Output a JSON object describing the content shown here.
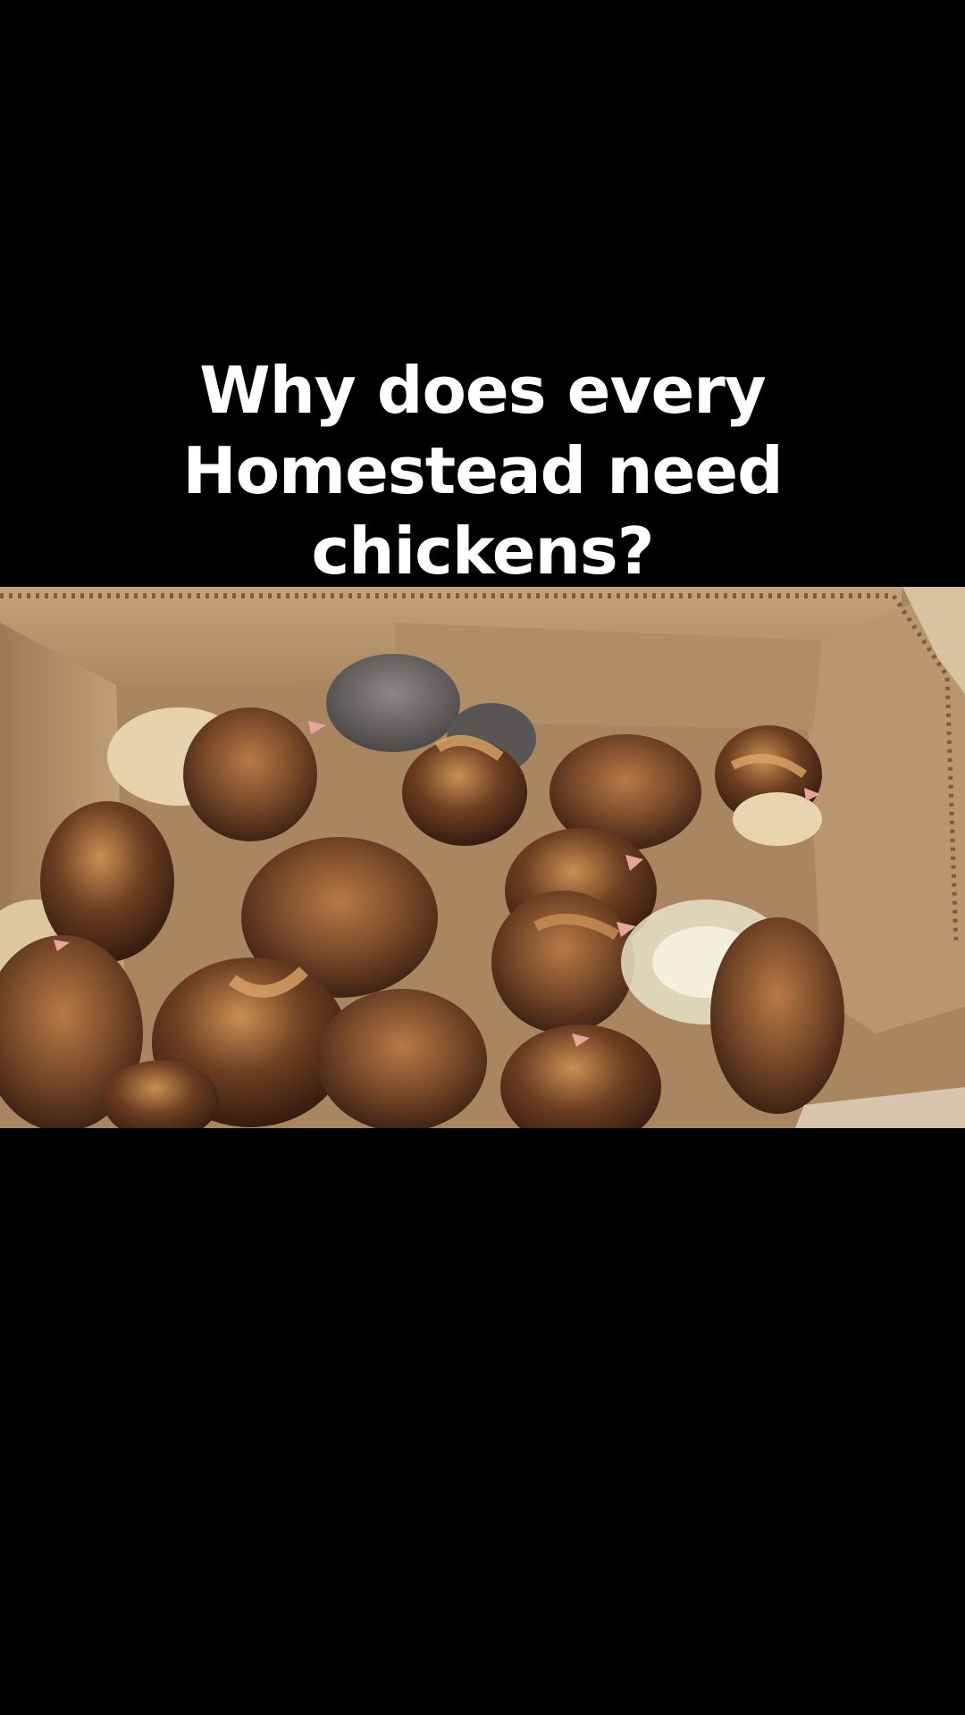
{
  "caption": {
    "line1": "Why does every",
    "line2": "Homestead need",
    "line3": "chickens?"
  },
  "photo": {
    "subject": "chicks-in-cardboard-box",
    "colors": {
      "box": "#b8956a",
      "box_shadow": "#8c6a45",
      "chick_dark": "#4a2a18",
      "chick_mid": "#7a4a2a",
      "chick_light": "#b87a45",
      "chick_grey": "#6f6a6a",
      "bowl": "#e8e2c8"
    }
  }
}
